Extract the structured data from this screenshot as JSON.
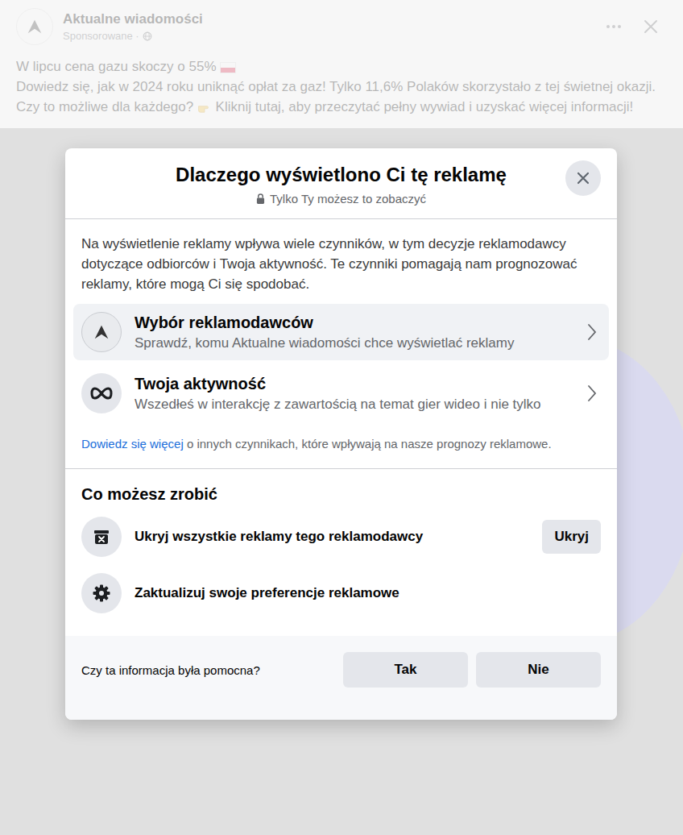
{
  "post": {
    "advertiser": "Aktualne wiadomości",
    "sponsored": "Sponsorowane ·",
    "headline": "W lipcu cena gazu skoczy o 55%",
    "body_before": "Dowiedz się, jak w 2024 roku uniknąć opłat za gaz! Tylko 11,6% Polaków skorzystało z tej świetnej okazji. Czy to możliwe dla każdego?",
    "body_after": "Kliknij tutaj, aby przeczytać pełny wywiad i uzyskać więcej informacji!"
  },
  "dialog": {
    "title": "Dlaczego wyświetlono Ci tę reklamę",
    "privacy": "Tylko Ty możesz to zobaczyć",
    "intro": "Na wyświetlenie reklamy wpływa wiele czynników, w tym decyzje reklamodawcy dotyczące odbiorców i Twoja aktywność. Te czynniki pomagają nam prognozować reklamy, które mogą Ci się spodobać.",
    "reasons": [
      {
        "title": "Wybór reklamodawców",
        "subtitle": "Sprawdź, komu Aktualne wiadomości chce wyświetlać reklamy",
        "kind": "advertiser",
        "hovered": true
      },
      {
        "title": "Twoja aktywność",
        "subtitle": "Wszedłeś w interakcję z zawartością na temat gier wideo i nie tylko",
        "kind": "meta",
        "hovered": false
      }
    ],
    "learn_more": {
      "link": "Dowiedz się więcej",
      "rest": " o innych czynnikach, które wpływają na nasze prognozy reklamowe."
    },
    "actions_title": "Co możesz zrobić",
    "actions": [
      {
        "label": "Ukryj wszystkie reklamy tego reklamodawcy",
        "kind": "hide",
        "button": "Ukryj"
      },
      {
        "label": "Zaktualizuj swoje preferencje reklamowe",
        "kind": "preferences",
        "button": ""
      }
    ],
    "feedback": {
      "question": "Czy ta informacja była pomocna?",
      "buttons": [
        "Tak",
        "Nie"
      ]
    }
  }
}
